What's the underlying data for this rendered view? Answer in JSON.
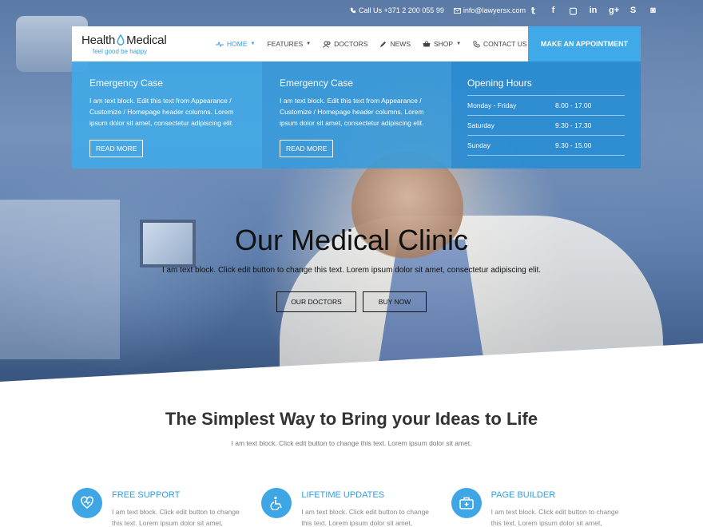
{
  "topbar": {
    "phone": "Call Us +371 2 200 055 99",
    "email": "info@lawyersx.com"
  },
  "social": [
    "twitter-icon",
    "facebook-icon",
    "vimeo-icon",
    "linkedin-icon",
    "googleplus-icon",
    "skype-icon",
    "rss-icon"
  ],
  "logo": {
    "title_a": "Health",
    "title_b": "Medical",
    "tagline": "feel good be happy"
  },
  "nav": {
    "items": [
      {
        "label": "HOME",
        "has_caret": true,
        "active": true
      },
      {
        "label": "FEATURES",
        "has_caret": true
      },
      {
        "label": "DOCTORS"
      },
      {
        "label": "NEWS"
      },
      {
        "label": "SHOP",
        "has_caret": true
      },
      {
        "label": "CONTACT US"
      }
    ],
    "cta": "MAKE AN APPOINTMENT"
  },
  "panels": {
    "emergency1": {
      "title": "Emergency Case",
      "text": "I am text block. Edit this text from Appearance / Customize / Homepage header columns. Lorem ipsum dolor sit amet, consectetur adipiscing elit.",
      "button": "READ MORE"
    },
    "emergency2": {
      "title": "Emergency Case",
      "text": "I am text block. Edit this text from Appearance / Customize / Homepage header columns. Lorem ipsum dolor sit amet, consectetur adipiscing elit.",
      "button": "READ MORE"
    },
    "hours": {
      "title": "Opening Hours",
      "rows": [
        {
          "day": "Monday - Friday",
          "time": "8.00 - 17.00"
        },
        {
          "day": "Saturday",
          "time": "9.30 - 17.30"
        },
        {
          "day": "Sunday",
          "time": "9.30 - 15.00"
        }
      ]
    }
  },
  "hero": {
    "title": "Our Medical Clinic",
    "subtitle": "I am text block. Click edit button to change this text. Lorem ipsum dolor sit amet, consectetur adipiscing elit.",
    "btn1": "OUR DOCTORS",
    "btn2": "BUY NOW"
  },
  "section": {
    "title": "The Simplest Way to Bring your Ideas to Life",
    "subtitle": "I am text block. Click edit button to change this text. Lorem ipsum dolor sit amet."
  },
  "features": [
    {
      "icon": "heart-hand-icon",
      "title": "FREE SUPPORT",
      "text": "I am text block. Click edit button to change this text. Lorem ipsum dolor sit amet,"
    },
    {
      "icon": "wheelchair-icon",
      "title": "LIFETIME UPDATES",
      "text": "I am text block. Click edit button to change this text. Lorem ipsum dolor sit amet,"
    },
    {
      "icon": "first-aid-kit-icon",
      "title": "PAGE BUILDER",
      "text": "I am text block. Click edit button to change this text. Lorem ipsum dolor sit amet,"
    }
  ],
  "colors": {
    "accent": "#40a9e8",
    "accent_dark": "#2f9ee0"
  }
}
